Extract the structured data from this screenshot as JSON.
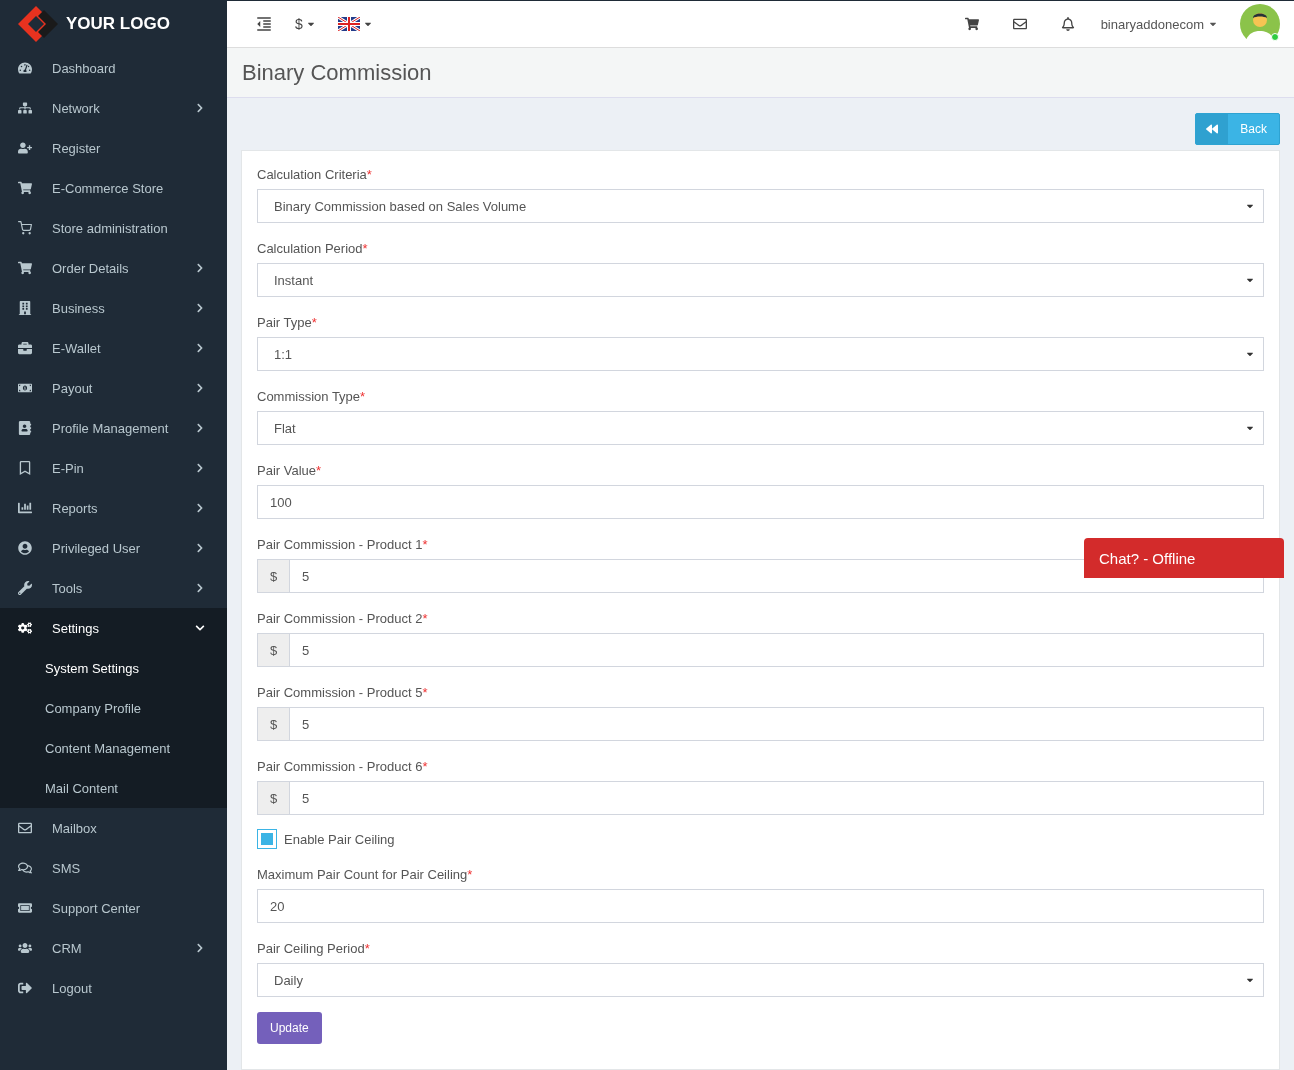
{
  "logo": {
    "text": "YOUR LOGO"
  },
  "sidebar": {
    "items": [
      {
        "label": "Dashboard",
        "has_arrow": false,
        "expanded": false
      },
      {
        "label": "Network",
        "has_arrow": true,
        "expanded": false
      },
      {
        "label": "Register",
        "has_arrow": false,
        "expanded": false
      },
      {
        "label": "E-Commerce Store",
        "has_arrow": false,
        "expanded": false
      },
      {
        "label": "Store administration",
        "has_arrow": false,
        "expanded": false
      },
      {
        "label": "Order Details",
        "has_arrow": true,
        "expanded": false
      },
      {
        "label": "Business",
        "has_arrow": true,
        "expanded": false
      },
      {
        "label": "E-Wallet",
        "has_arrow": true,
        "expanded": false
      },
      {
        "label": "Payout",
        "has_arrow": true,
        "expanded": false
      },
      {
        "label": "Profile Management",
        "has_arrow": true,
        "expanded": false
      },
      {
        "label": "E-Pin",
        "has_arrow": true,
        "expanded": false
      },
      {
        "label": "Reports",
        "has_arrow": true,
        "expanded": false
      },
      {
        "label": "Privileged User",
        "has_arrow": true,
        "expanded": false
      },
      {
        "label": "Tools",
        "has_arrow": true,
        "expanded": false
      },
      {
        "label": "Settings",
        "has_arrow": true,
        "expanded": true,
        "children": [
          {
            "label": "System Settings",
            "selected": true
          },
          {
            "label": "Company Profile",
            "selected": false
          },
          {
            "label": "Content Management",
            "selected": false
          },
          {
            "label": "Mail Content",
            "selected": false
          }
        ]
      },
      {
        "label": "Mailbox",
        "has_arrow": false,
        "expanded": false
      },
      {
        "label": "SMS",
        "has_arrow": false,
        "expanded": false
      },
      {
        "label": "Support Center",
        "has_arrow": false,
        "expanded": false
      },
      {
        "label": "CRM",
        "has_arrow": true,
        "expanded": false
      },
      {
        "label": "Logout",
        "has_arrow": false,
        "expanded": false
      }
    ]
  },
  "topbar": {
    "currency": "$",
    "username": "binaryaddonecom",
    "online": true
  },
  "page_title": "Binary Commission",
  "back_button": "Back",
  "form": {
    "fields": [
      {
        "kind": "select",
        "label": "Calculation Criteria",
        "mark": "*",
        "value": "Binary Commission based on Sales Volume"
      },
      {
        "kind": "select",
        "label": "Calculation Period",
        "mark": "*",
        "value": "Instant"
      },
      {
        "kind": "select",
        "label": "Pair Type",
        "mark": "*",
        "value": "1:1"
      },
      {
        "kind": "select",
        "label": "Commission Type",
        "mark": "*",
        "value": "Flat"
      },
      {
        "kind": "text",
        "label": "Pair Value",
        "mark": "*",
        "value": "100"
      },
      {
        "kind": "addon",
        "label": "Pair Commission - Product 1",
        "mark": "*",
        "addon": "$",
        "value": "5"
      },
      {
        "kind": "addon",
        "label": "Pair Commission - Product 2",
        "mark": "*",
        "addon": "$",
        "value": "5"
      },
      {
        "kind": "addon",
        "label": "Pair Commission - Product 5",
        "mark": "*",
        "addon": "$",
        "value": "5"
      },
      {
        "kind": "addon",
        "label": "Pair Commission - Product 6",
        "mark": "*",
        "addon": "$",
        "value": "5"
      },
      {
        "kind": "checkbox",
        "label": "Enable Pair Ceiling",
        "checked": true
      },
      {
        "kind": "text",
        "label": "Maximum Pair Count for Pair Ceiling",
        "mark": "*",
        "value": "20"
      },
      {
        "kind": "select",
        "label": "Pair Ceiling Period",
        "mark": "*",
        "value": "Daily"
      }
    ],
    "submit": "Update"
  },
  "chat": {
    "label": "Chat? - Offline"
  }
}
